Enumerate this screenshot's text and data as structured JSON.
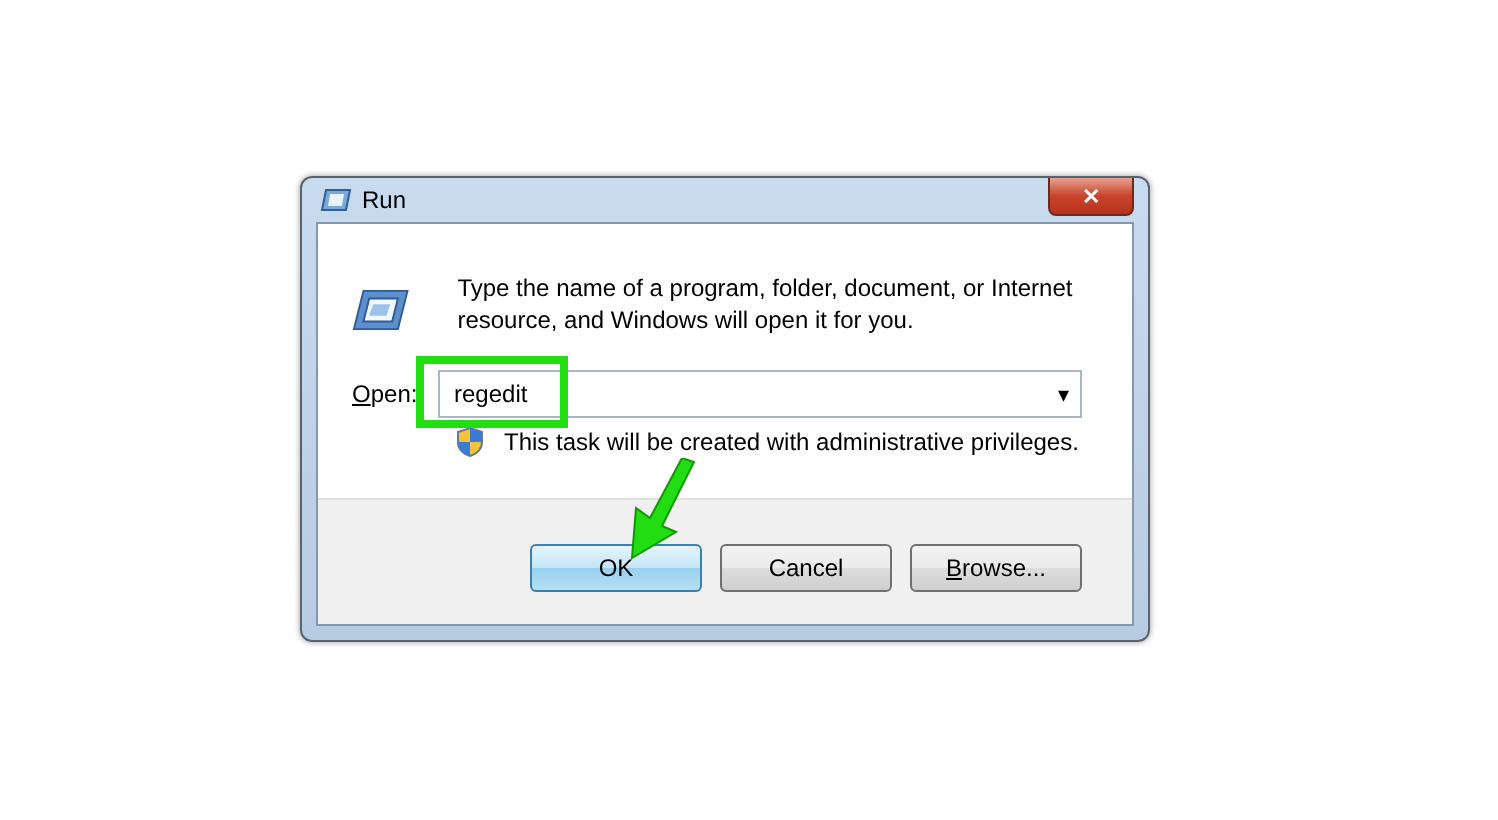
{
  "window": {
    "title": "Run",
    "close": "✕"
  },
  "message": "Type the name of a program, folder, document, or Internet resource, and Windows will open it for you.",
  "open_field": {
    "label": {
      "key": "O",
      "rest": "pen:"
    },
    "value": "regedit",
    "dropdown": "▾"
  },
  "admin_note": "This task will be created with administrative privileges.",
  "buttons": [
    {
      "label": {
        "rest": "OK"
      },
      "default": true
    },
    {
      "label": {
        "rest": "Cancel"
      },
      "default": false
    },
    {
      "label": {
        "key": "B",
        "rest": "rowse..."
      },
      "default": false
    }
  ],
  "highlight_box": {
    "color": "#22dd11"
  },
  "pointer_arrow": {
    "color": "#22dd11"
  }
}
